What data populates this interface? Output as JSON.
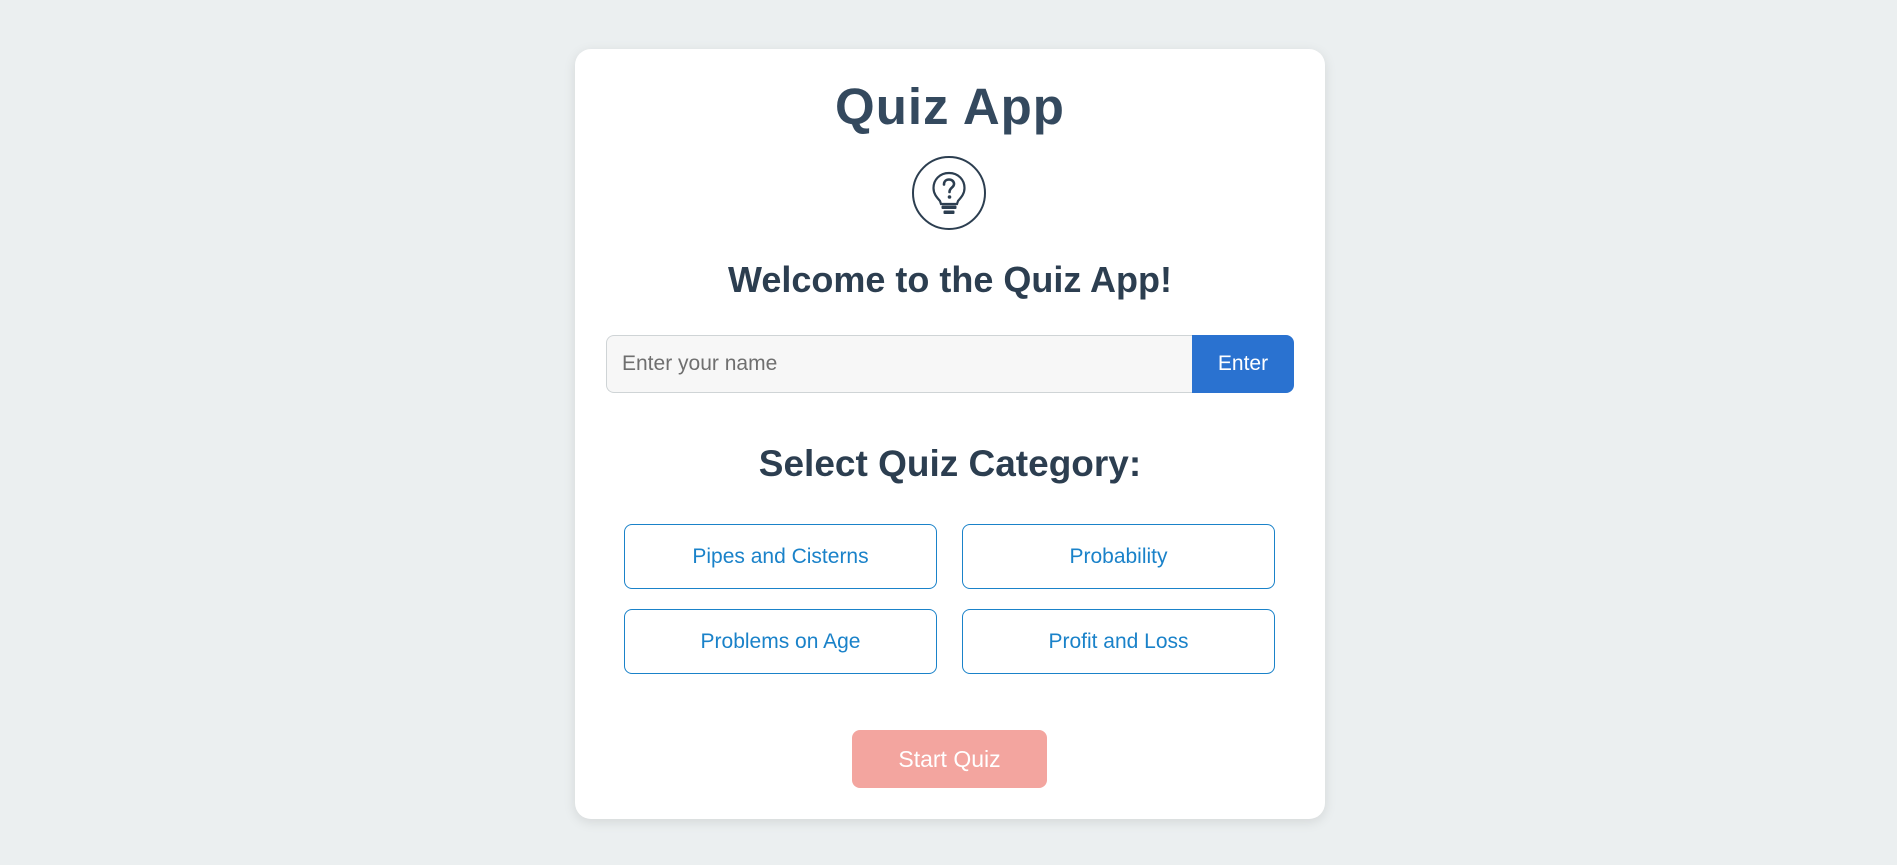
{
  "app": {
    "title": "Quiz App",
    "logo_icon": "lightbulb-question-icon",
    "welcome": "Welcome to the Quiz App!"
  },
  "name_entry": {
    "placeholder": "Enter your name",
    "value": "",
    "button_label": "Enter"
  },
  "categories": {
    "title": "Select Quiz Category:",
    "items": [
      {
        "label": "Pipes and Cisterns"
      },
      {
        "label": "Probability"
      },
      {
        "label": "Problems on Age"
      },
      {
        "label": "Profit and Loss"
      }
    ]
  },
  "start": {
    "label": "Start Quiz",
    "enabled": false
  },
  "colors": {
    "background": "#ebeff0",
    "heading": "#2c3e50",
    "primary": "#2a72d0",
    "category": "#1a82c9",
    "start_disabled": "#f3a59f"
  }
}
